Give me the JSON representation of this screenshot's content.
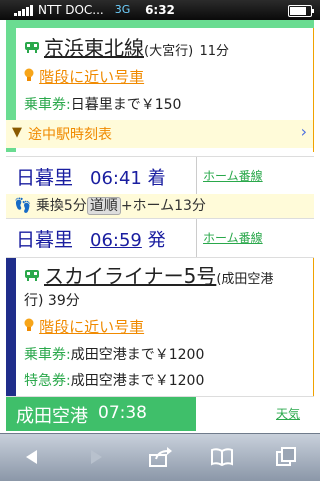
{
  "statusbar": {
    "carrier": "NTT DOC...",
    "network": "3G",
    "time": "6:32"
  },
  "segment1": {
    "line": "京浜東北線",
    "direction": "(大宮行)",
    "duration": "11分",
    "stairs_link": "階段に近い号車",
    "fare_label": "乗車券:",
    "fare_value": "日暮里まで￥150",
    "timetable_link": "途中駅時刻表",
    "stripe_color": "#6adc91"
  },
  "arrival": {
    "station": "日暮里",
    "time": "06:41 着",
    "platform_link": "ホーム番線"
  },
  "transfer": {
    "text1": "乗換5分",
    "pill": "道順",
    "text2": "+ホーム13分"
  },
  "departure": {
    "station": "日暮里",
    "time_link": "06:59",
    "time_suffix": "発",
    "platform_link": "ホーム番線"
  },
  "segment2": {
    "line": "スカイライナー5号",
    "direction": "(成田空港",
    "direction2": "行)",
    "duration": "39分",
    "stairs_link": "階段に近い号車",
    "fare_label": "乗車券:",
    "fare_value": "成田空港まで￥1200",
    "express_label": "特急券:",
    "express_value": "成田空港まで￥1200",
    "stripe_color": "#1f2d8a"
  },
  "destination": {
    "station": "成田空港",
    "time": "07:38",
    "weather_link": "天気",
    "bg": "#3fbf6a"
  },
  "toolbar": {
    "back_icon": "back-arrow",
    "forward_icon": "forward-arrow",
    "share_icon": "share",
    "bookmarks_icon": "book",
    "pages_icon": "pages"
  }
}
